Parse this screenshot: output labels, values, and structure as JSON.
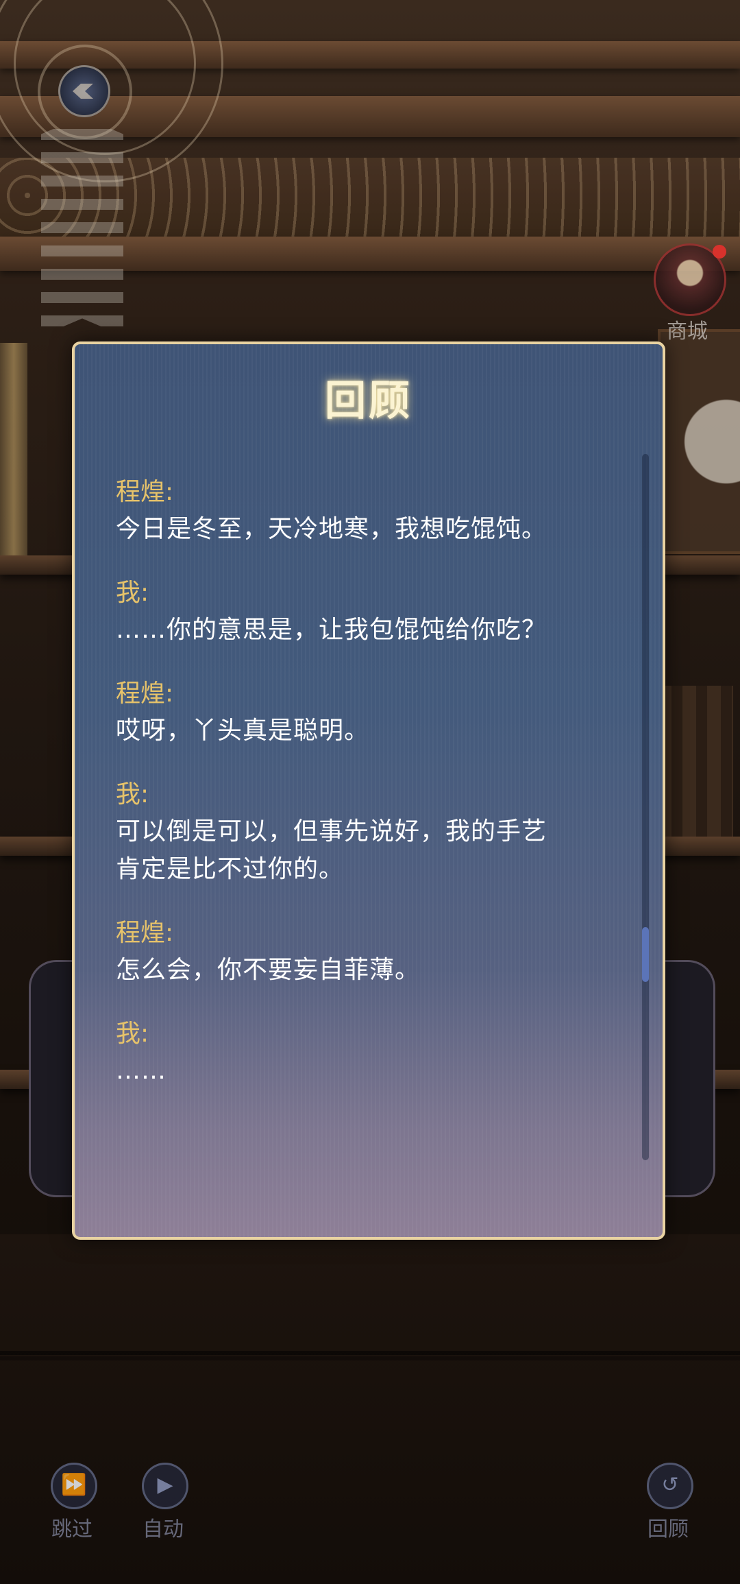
{
  "shop": {
    "label": "商城"
  },
  "review_dialog": {
    "title": "回顾",
    "entries": [
      {
        "speaker": "程煌:",
        "lines": [
          "今日是冬至，天冷地寒，我想吃馄饨。"
        ]
      },
      {
        "speaker": "我:",
        "lines": [
          "……你的意思是，让我包馄饨给你吃？"
        ]
      },
      {
        "speaker": "程煌:",
        "lines": [
          "哎呀，丫头真是聪明。"
        ]
      },
      {
        "speaker": "我:",
        "lines": [
          "可以倒是可以，但事先说好，我的手艺",
          "肯定是比不过你的。"
        ]
      },
      {
        "speaker": "程煌:",
        "lines": [
          "怎么会，你不要妄自菲薄。"
        ]
      },
      {
        "speaker": "我:",
        "lines": [
          "……"
        ]
      }
    ]
  },
  "controls": {
    "skip": {
      "label": "跳过",
      "icon": "fast-forward-icon"
    },
    "auto": {
      "label": "自动",
      "icon": "play-icon"
    },
    "review": {
      "label": "回顾",
      "icon": "rewind-icon"
    }
  },
  "colors": {
    "speaker": "#e7c36a",
    "dialog_border": "#e9d3a2",
    "scroll_thumb": "#5b74b8"
  }
}
